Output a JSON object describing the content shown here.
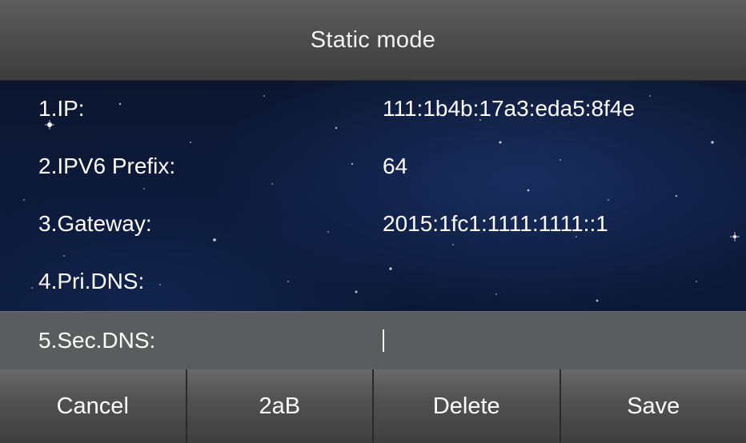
{
  "screen": {
    "title": "Static mode"
  },
  "fields": [
    {
      "label": "1.IP:",
      "value": "111:1b4b:17a3:eda5:8f4e"
    },
    {
      "label": "2.IPV6 Prefix:",
      "value": "64"
    },
    {
      "label": "3.Gateway:",
      "value": "2015:1fc1:1111:1111::1"
    },
    {
      "label": "4.Pri.DNS:",
      "value": ""
    },
    {
      "label": "5.Sec.DNS:",
      "value": ""
    }
  ],
  "softkeys": {
    "cancel": "Cancel",
    "input_mode": "2aB",
    "delete": "Delete",
    "save": "Save"
  },
  "colors": {
    "title_bar": "#4a4a4a",
    "selected_row": "#5a5c5e",
    "background": "#0c1a3a",
    "text": "#ffffff"
  }
}
